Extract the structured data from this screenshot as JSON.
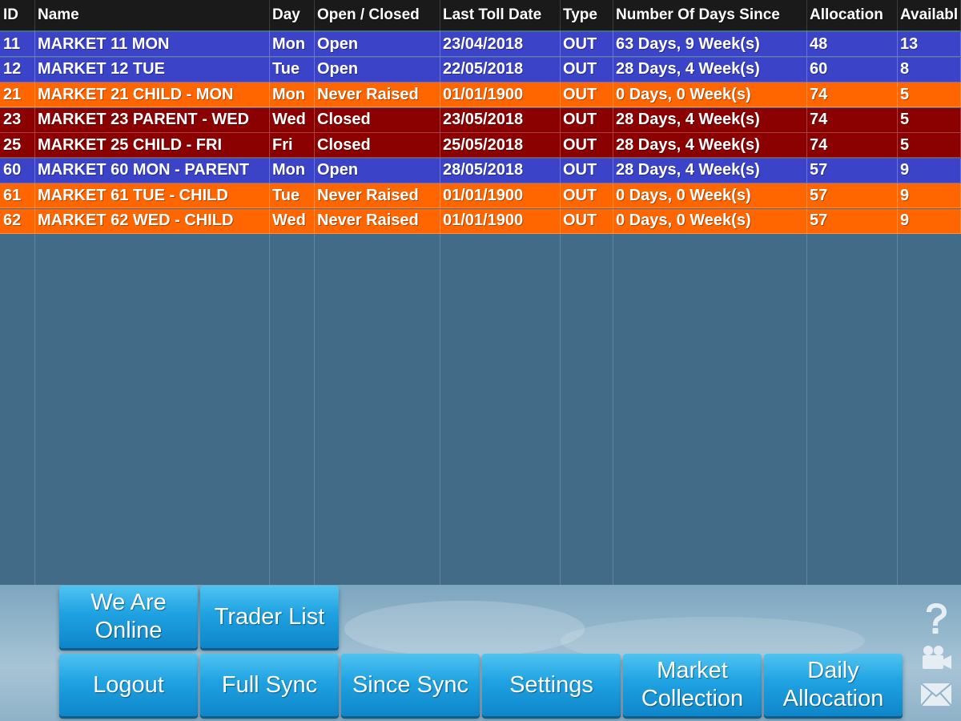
{
  "table": {
    "columns": [
      "ID",
      "Name",
      "Day",
      "Open / Closed",
      "Last Toll Date",
      "Type",
      "Number Of Days Since",
      "Allocation",
      "Availabl"
    ],
    "rows": [
      {
        "id": "11",
        "name": "MARKET 11 MON",
        "day": "Mon",
        "status": "Open",
        "date": "23/04/2018",
        "type": "OUT",
        "since": "63 Days, 9 Week(s)",
        "allocation": "48",
        "available": "13",
        "color": "blue"
      },
      {
        "id": "12",
        "name": "MARKET 12 TUE",
        "day": "Tue",
        "status": "Open",
        "date": "22/05/2018",
        "type": "OUT",
        "since": "28 Days, 4 Week(s)",
        "allocation": "60",
        "available": "8",
        "color": "blue"
      },
      {
        "id": "21",
        "name": "MARKET 21 CHILD - MON",
        "day": "Mon",
        "status": "Never Raised",
        "date": "01/01/1900",
        "type": "OUT",
        "since": "0 Days, 0 Week(s)",
        "allocation": "74",
        "available": "5",
        "color": "orange"
      },
      {
        "id": "23",
        "name": "MARKET 23 PARENT - WED",
        "day": "Wed",
        "status": "Closed",
        "date": "23/05/2018",
        "type": "OUT",
        "since": "28 Days, 4 Week(s)",
        "allocation": "74",
        "available": "5",
        "color": "darkred"
      },
      {
        "id": "25",
        "name": "MARKET 25 CHILD - FRI",
        "day": "Fri",
        "status": "Closed",
        "date": "25/05/2018",
        "type": "OUT",
        "since": "28 Days, 4 Week(s)",
        "allocation": "74",
        "available": "5",
        "color": "darkred"
      },
      {
        "id": "60",
        "name": "MARKET 60 MON - PARENT",
        "day": "Mon",
        "status": "Open",
        "date": "28/05/2018",
        "type": "OUT",
        "since": "28 Days, 4 Week(s)",
        "allocation": "57",
        "available": "9",
        "color": "blue"
      },
      {
        "id": "61",
        "name": "MARKET 61 TUE - CHILD",
        "day": "Tue",
        "status": "Never Raised",
        "date": "01/01/1900",
        "type": "OUT",
        "since": "0 Days, 0 Week(s)",
        "allocation": "57",
        "available": "9",
        "color": "orange"
      },
      {
        "id": "62",
        "name": "MARKET 62 WED - CHILD",
        "day": "Wed",
        "status": "Never Raised",
        "date": "01/01/1900",
        "type": "OUT",
        "since": "0 Days, 0 Week(s)",
        "allocation": "57",
        "available": "9",
        "color": "orange"
      }
    ]
  },
  "colors": {
    "blue": "#3b44c8",
    "orange": "#ff6600",
    "darkred": "#8b0000",
    "header": "#1a1a1a",
    "background": "#416b86"
  },
  "buttons": {
    "we_are_online": "We Are Online",
    "trader_list": "Trader List",
    "logout": "Logout",
    "full_sync": "Full Sync",
    "since_sync": "Since Sync",
    "settings": "Settings",
    "market_collection": "Market Collection",
    "daily_allocation": "Daily Allocation"
  },
  "icons": {
    "help": "question-mark-icon",
    "video": "video-camera-icon",
    "mail": "envelope-icon"
  }
}
